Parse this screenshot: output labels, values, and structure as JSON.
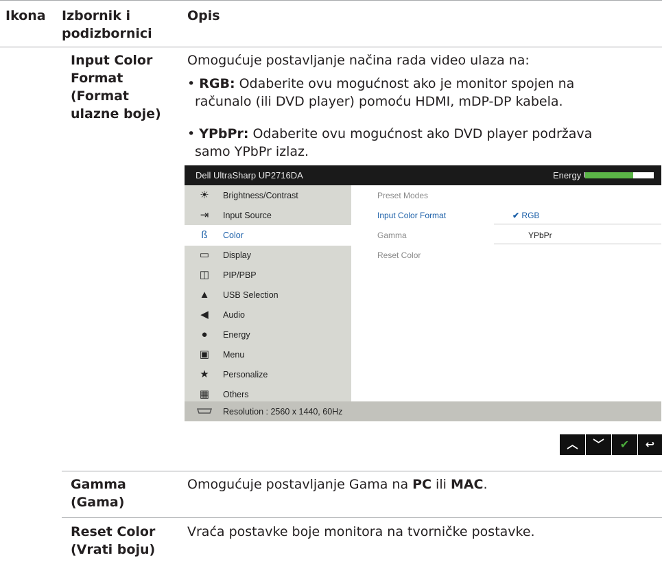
{
  "header": {
    "col_icon": "Ikona",
    "col_menu_line1": "Izbornik i",
    "col_menu_line2": "podizbornici",
    "col_desc": "Opis"
  },
  "rows": [
    {
      "menu_lines": [
        "Input Color",
        "Format",
        "(Format",
        "ulazne boje)"
      ],
      "intro": "Omogućuje postavljanje načina rada video ulaza na:",
      "bullets": [
        {
          "term": "RGB:",
          "line1": " Odaberite ovu mogućnost ako je monitor spojen na",
          "line2": "računalo (ili DVD player) pomoću HDMI, mDP-DP kabela."
        },
        {
          "term": "YPbPr:",
          "line1": " Odaberite ovu mogućnost ako DVD player podržava",
          "line2": "samo YPbPr izlaz."
        }
      ]
    },
    {
      "menu_lines": [
        "Gamma",
        "(Gama)"
      ],
      "desc_pre": "Omogućuje postavljanje Gama na ",
      "desc_b1": "PC",
      "desc_mid": " ili ",
      "desc_b2": "MAC",
      "desc_post": "."
    },
    {
      "menu_lines": [
        "Reset Color",
        "(Vrati boju)"
      ],
      "desc": "Vraća postavke boje monitora na tvorničke postavke."
    }
  ],
  "osd": {
    "title": "Dell UltraSharp UP2716DA",
    "energy_label": "Energy Use",
    "energy_level": 0.7,
    "menu": [
      {
        "label": "Brightness/Contrast",
        "icon": "brightness-icon"
      },
      {
        "label": "Input Source",
        "icon": "input-source-icon"
      },
      {
        "label": "Color",
        "icon": "color-icon"
      },
      {
        "label": "Display",
        "icon": "display-icon"
      },
      {
        "label": "PIP/PBP",
        "icon": "pip-pbp-icon"
      },
      {
        "label": "USB Selection",
        "icon": "usb-icon"
      },
      {
        "label": "Audio",
        "icon": "audio-icon"
      },
      {
        "label": "Energy",
        "icon": "energy-icon"
      },
      {
        "label": "Menu",
        "icon": "menu-icon"
      },
      {
        "label": "Personalize",
        "icon": "star-icon"
      },
      {
        "label": "Others",
        "icon": "others-icon"
      }
    ],
    "submenu": [
      "Preset Modes",
      "Input Color Format",
      "Gamma",
      "Reset Color"
    ],
    "options": [
      "RGB",
      "YPbPr"
    ],
    "footer": "Resolution : 2560 x 1440, 60Hz",
    "accent_color": "#1b5fa8"
  },
  "nav_buttons": [
    "up-icon",
    "down-icon",
    "check-icon",
    "back-icon"
  ]
}
